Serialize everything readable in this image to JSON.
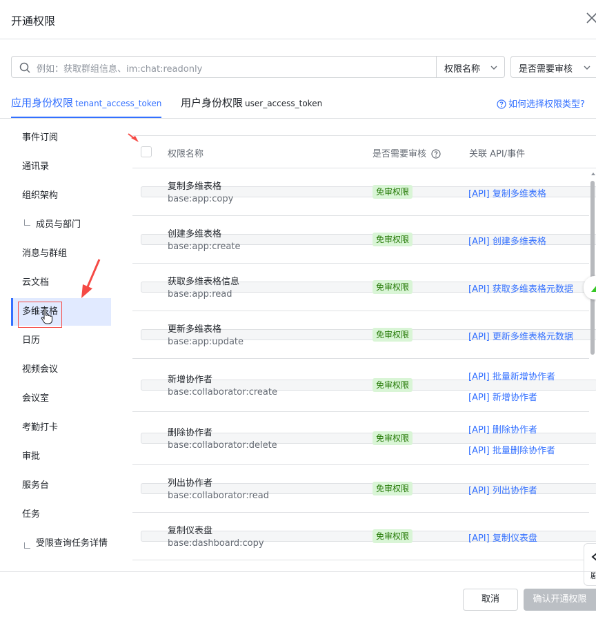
{
  "dialog": {
    "title": "开通权限"
  },
  "search": {
    "placeholder": "例如：获取群组信息、im:chat:readonly"
  },
  "filters": {
    "name_label": "权限名称",
    "review_label": "是否需要审核"
  },
  "tabs": [
    {
      "label": "应用身份权限",
      "sub": "tenant_access_token"
    },
    {
      "label": "用户身份权限",
      "sub": "user_access_token"
    }
  ],
  "help_link": "如何选择权限类型?",
  "sidebar": {
    "items": [
      {
        "label": "事件订阅"
      },
      {
        "label": "通讯录"
      },
      {
        "label": "组织架构"
      },
      {
        "label": "成员与部门"
      },
      {
        "label": "消息与群组"
      },
      {
        "label": "云文档"
      },
      {
        "label": "多维表格"
      },
      {
        "label": "日历"
      },
      {
        "label": "视频会议"
      },
      {
        "label": "会议室"
      },
      {
        "label": "考勤打卡"
      },
      {
        "label": "审批"
      },
      {
        "label": "服务台"
      },
      {
        "label": "任务"
      },
      {
        "label": "受限查询任务详情"
      }
    ]
  },
  "table": {
    "headers": {
      "name": "权限名称",
      "review": "是否需要审核",
      "api": "关联 API/事件"
    },
    "rows": [
      {
        "name": "复制多维表格",
        "code": "base:app:copy",
        "badge": "免审权限",
        "apis": [
          "[API] 复制多维表格"
        ]
      },
      {
        "name": "创建多维表格",
        "code": "base:app:create",
        "badge": "免审权限",
        "apis": [
          "[API] 创建多维表格"
        ]
      },
      {
        "name": "获取多维表格信息",
        "code": "base:app:read",
        "badge": "免审权限",
        "apis": [
          "[API] 获取多维表格元数据"
        ]
      },
      {
        "name": "更新多维表格",
        "code": "base:app:update",
        "badge": "免审权限",
        "apis": [
          "[API] 更新多维表格元数据"
        ]
      },
      {
        "name": "新增协作者",
        "code": "base:collaborator:create",
        "badge": "免审权限",
        "apis": [
          "[API] 批量新增协作者",
          "[API] 新增协作者"
        ]
      },
      {
        "name": "删除协作者",
        "code": "base:collaborator:delete",
        "badge": "免审权限",
        "apis": [
          "[API] 删除协作者",
          "[API] 批量删除协作者"
        ]
      },
      {
        "name": "列出协作者",
        "code": "base:collaborator:read",
        "badge": "免审权限",
        "apis": [
          "[API] 列出协作者"
        ]
      },
      {
        "name": "复制仪表盘",
        "code": "base:dashboard:copy",
        "badge": "免审权限",
        "apis": [
          "[API] 复制仪表盘"
        ]
      }
    ]
  },
  "side_tab": {
    "text": "剧"
  },
  "footer": {
    "cancel": "取消",
    "confirm": "确认开通权限"
  },
  "colors": {
    "accent": "#3370ff",
    "badge_bg": "#d9f5d6",
    "badge_text": "#237804",
    "annotation": "#f54a45"
  }
}
